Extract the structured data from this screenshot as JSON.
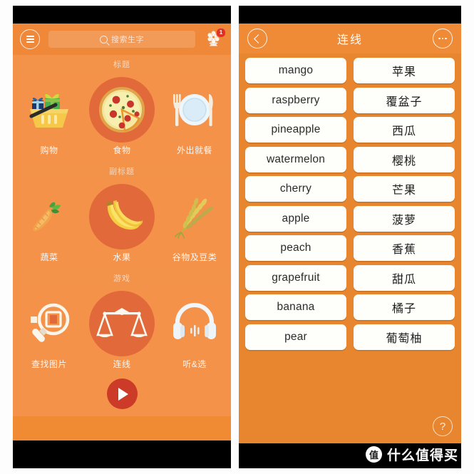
{
  "left_phone": {
    "topbar": {
      "menu_icon": "hamburger-menu-icon",
      "search_placeholder": "搜索生字",
      "search_icon": "search-icon",
      "settings_icon": "flower-gear-icon",
      "badge_count": "1"
    },
    "sections": [
      {
        "heading": "标题",
        "tiles": [
          {
            "label": "购物",
            "icon": "shopping-basket-gift-icon",
            "featured": false
          },
          {
            "label": "食物",
            "icon": "pizza-icon",
            "featured": true
          },
          {
            "label": "外出就餐",
            "icon": "fork-plate-knife-icon",
            "featured": false
          }
        ]
      },
      {
        "heading": "副标题",
        "tiles": [
          {
            "label": "蔬菜",
            "icon": "carrot-icon",
            "featured": false
          },
          {
            "label": "水果",
            "icon": "banana-icon",
            "featured": true
          },
          {
            "label": "谷物及豆类",
            "icon": "wheat-icon",
            "featured": false
          }
        ]
      },
      {
        "heading": "游戏",
        "tiles": [
          {
            "label": "查找图片",
            "icon": "magnifier-picture-icon",
            "featured": false
          },
          {
            "label": "连线",
            "icon": "balance-scale-icon",
            "featured": true
          },
          {
            "label": "听&选",
            "icon": "headphones-icon",
            "featured": false
          }
        ]
      }
    ],
    "play_button": {
      "icon": "play-icon",
      "color": "#cc3b27"
    }
  },
  "right_phone": {
    "nav": {
      "back_icon": "chevron-left-icon",
      "title": "连线",
      "more_icon": "ellipsis-icon"
    },
    "match_rows": [
      {
        "english": "mango",
        "chinese": "苹果"
      },
      {
        "english": "raspberry",
        "chinese": "覆盆子"
      },
      {
        "english": "pineapple",
        "chinese": "西瓜"
      },
      {
        "english": "watermelon",
        "chinese": "樱桃"
      },
      {
        "english": "cherry",
        "chinese": "芒果"
      },
      {
        "english": "apple",
        "chinese": "菠萝"
      },
      {
        "english": "peach",
        "chinese": "香蕉"
      },
      {
        "english": "grapefruit",
        "chinese": "甜瓜"
      },
      {
        "english": "banana",
        "chinese": "橘子"
      },
      {
        "english": "pear",
        "chinese": "葡萄柚"
      }
    ],
    "help_button": {
      "label": "?",
      "icon": "question-mark-icon"
    }
  },
  "watermark": {
    "badge": "值",
    "text": "什么值得买"
  },
  "colors": {
    "screen_bg": "#f4924a",
    "topbar": "#f0883a",
    "band": "#f3934a",
    "featured_circle": "#e2693a",
    "right_bg": "#e8862f",
    "nav_bg": "#ef8a36",
    "card_bg": "#fefefb",
    "badge_red": "#e03127",
    "play_red": "#cc3b27"
  }
}
